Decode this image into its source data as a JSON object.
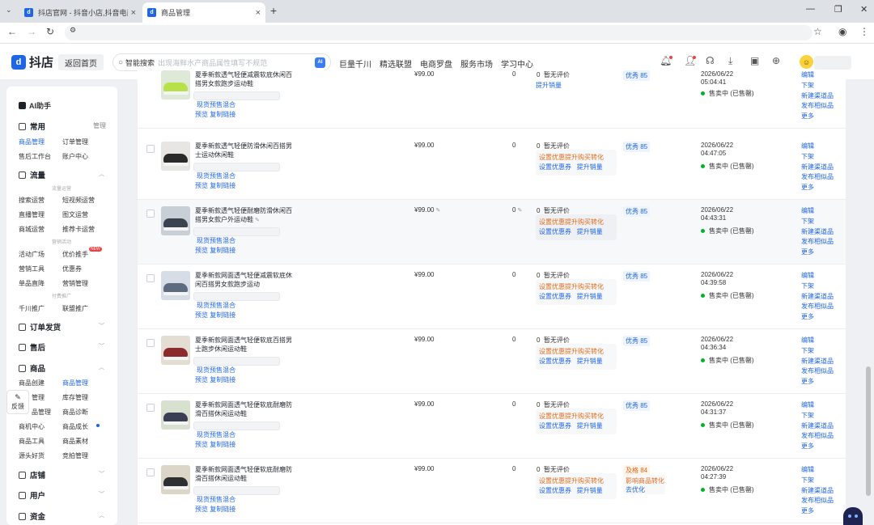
{
  "browser": {
    "tabs": [
      {
        "title": "抖店官网 - 抖音小店,抖音电商",
        "active": false
      },
      {
        "title": "商品管理",
        "active": true
      }
    ]
  },
  "header": {
    "logo_text": "抖店",
    "home_button": "返回首页",
    "search_label": "智能搜索",
    "search_placeholder": "出现海鲜水产商品属性填写不规范",
    "search_ai": "AI",
    "nav": [
      "巨量千川",
      "精选联盟",
      "电商罗盘",
      "服务市场",
      "学习中心"
    ]
  },
  "sidebar": {
    "ai_assistant": "AI助手",
    "common": {
      "title": "常用",
      "manage": "管理",
      "items": [
        "商品管理",
        "订单管理",
        "售后工作台",
        "账户中心"
      ]
    },
    "traffic": {
      "title": "流量",
      "sub1": "流量运营",
      "items1": [
        "搜索运营",
        "短视频运营",
        "直播管理",
        "图文运营",
        "商城运营",
        "推荐卡运营"
      ],
      "sub2": "营销活动",
      "items2": [
        "活动广场",
        "优价推手",
        "营销工具",
        "优惠券",
        "单品直降",
        "营销管理"
      ],
      "new_badge": "NEW",
      "sub3": "付费推广",
      "items3": [
        "千川推广",
        "联盟推广"
      ]
    },
    "order_ship": "订单发货",
    "after_sale": "售后",
    "goods": {
      "title": "商品",
      "items": [
        "商品创建",
        "商品管理",
        "",
        "库存管理",
        "",
        "商品诊断",
        "商机中心",
        "商品成长",
        "商品工具",
        "商品素材",
        "源头好货",
        "竞拍管理"
      ],
      "partial": [
        "管理",
        "品管理"
      ]
    },
    "store": "店铺",
    "users": "用户",
    "funds": "资金",
    "feedback": "反馈"
  },
  "rows": [
    {
      "name": "夏季新款透气轻便减震软底休闲百搭男女款跑步运动鞋",
      "price": "¥99.00",
      "stock": "0",
      "rev_count": "0",
      "rev_text": "暂无评价",
      "act_orange": "",
      "act_links": [
        "提升销量"
      ],
      "score": "优秀 85",
      "warn": "",
      "warn_link": "",
      "date": "2026/06/22",
      "time": "05:04:41",
      "status": "售卖中 (已售罄)",
      "tag": "现货预售混合",
      "links": "预览  复制链接",
      "ops": [
        "编辑",
        "下架",
        "新建渠道品",
        "发布相似品",
        "更多"
      ]
    },
    {
      "name": "夏季新款透气轻便防滑休闲百搭男士运动休闲鞋",
      "price": "¥99.00",
      "stock": "0",
      "rev_count": "0",
      "rev_text": "暂无评价",
      "act_orange": "设置优惠提升购买转化",
      "act_links": [
        "设置优惠券",
        "提升销量"
      ],
      "score": "优秀 85",
      "warn": "",
      "warn_link": "",
      "date": "2026/06/22",
      "time": "04:47:05",
      "status": "售卖中 (已售罄)",
      "tag": "现货预售混合",
      "links": "预览  复制链接",
      "ops": [
        "编辑",
        "下架",
        "新建渠道品",
        "发布相似品",
        "更多"
      ]
    },
    {
      "name": "夏季新款透气轻便耐磨防滑休闲百搭男女款户外运动鞋",
      "price": "¥99.00",
      "stock": "0",
      "rev_count": "0",
      "rev_text": "暂无评价",
      "act_orange": "设置优惠提升购买转化",
      "act_links": [
        "设置优惠券",
        "提升销量"
      ],
      "score": "优秀 85",
      "warn": "",
      "warn_link": "",
      "date": "2026/06/22",
      "time": "04:43:31",
      "status": "售卖中 (已售罄)",
      "tag": "现货预售混合",
      "links": "预览  复制链接",
      "ops": [
        "编辑",
        "下架",
        "新建渠道品",
        "发布相似品",
        "更多"
      ]
    },
    {
      "name": "夏季新款网面透气轻便减震软底休闲百搭男女款跑步运动",
      "price": "¥99.00",
      "stock": "0",
      "rev_count": "0",
      "rev_text": "暂无评价",
      "act_orange": "设置优惠提升购买转化",
      "act_links": [
        "设置优惠券",
        "提升销量"
      ],
      "score": "优秀 85",
      "warn": "",
      "warn_link": "",
      "date": "2026/06/22",
      "time": "04:39:58",
      "status": "售卖中 (已售罄)",
      "tag": "现货预售混合",
      "links": "预览  复制链接",
      "ops": [
        "编辑",
        "下架",
        "新建渠道品",
        "发布相似品",
        "更多"
      ]
    },
    {
      "name": "夏季新款网面透气轻便软底百搭男士跑步休闲运动鞋",
      "price": "¥99.00",
      "stock": "0",
      "rev_count": "0",
      "rev_text": "暂无评价",
      "act_orange": "设置优惠提升购买转化",
      "act_links": [
        "设置优惠券",
        "提升销量"
      ],
      "score": "优秀 85",
      "warn": "",
      "warn_link": "",
      "date": "2026/06/22",
      "time": "04:36:34",
      "status": "售卖中 (已售罄)",
      "tag": "现货预售混合",
      "links": "预览  复制链接",
      "ops": [
        "编辑",
        "下架",
        "新建渠道品",
        "发布相似品",
        "更多"
      ]
    },
    {
      "name": "夏季新款网面透气轻便软底耐磨防滑百搭休闲运动鞋",
      "price": "¥99.00",
      "stock": "0",
      "rev_count": "0",
      "rev_text": "暂无评价",
      "act_orange": "设置优惠提升购买转化",
      "act_links": [
        "设置优惠券",
        "提升销量"
      ],
      "score": "优秀 85",
      "warn": "",
      "warn_link": "",
      "date": "2026/06/22",
      "time": "04:31:37",
      "status": "售卖中 (已售罄)",
      "tag": "现货预售混合",
      "links": "预览  复制链接",
      "ops": [
        "编辑",
        "下架",
        "新建渠道品",
        "发布相似品",
        "更多"
      ]
    },
    {
      "name": "夏季新款网面透气轻便软底耐磨防滑百搭休闲运动鞋",
      "price": "¥99.00",
      "stock": "0",
      "rev_count": "0",
      "rev_text": "暂无评价",
      "act_orange": "设置优惠提升购买转化",
      "act_links": [
        "设置优惠券",
        "提升销量"
      ],
      "score": "及格 84",
      "warn": "影响商品转化",
      "warn_link": "去优化",
      "date": "2026/06/22",
      "time": "04:27:39",
      "status": "售卖中 (已售罄)",
      "tag": "现货预售混合",
      "links": "预览  复制链接",
      "ops": [
        "编辑",
        "下架",
        "新建渠道品",
        "发布相似品",
        "更多"
      ]
    }
  ],
  "colors": {
    "accent": "#1f66e5",
    "warning": "#e36b1c",
    "success": "#00b42a"
  }
}
